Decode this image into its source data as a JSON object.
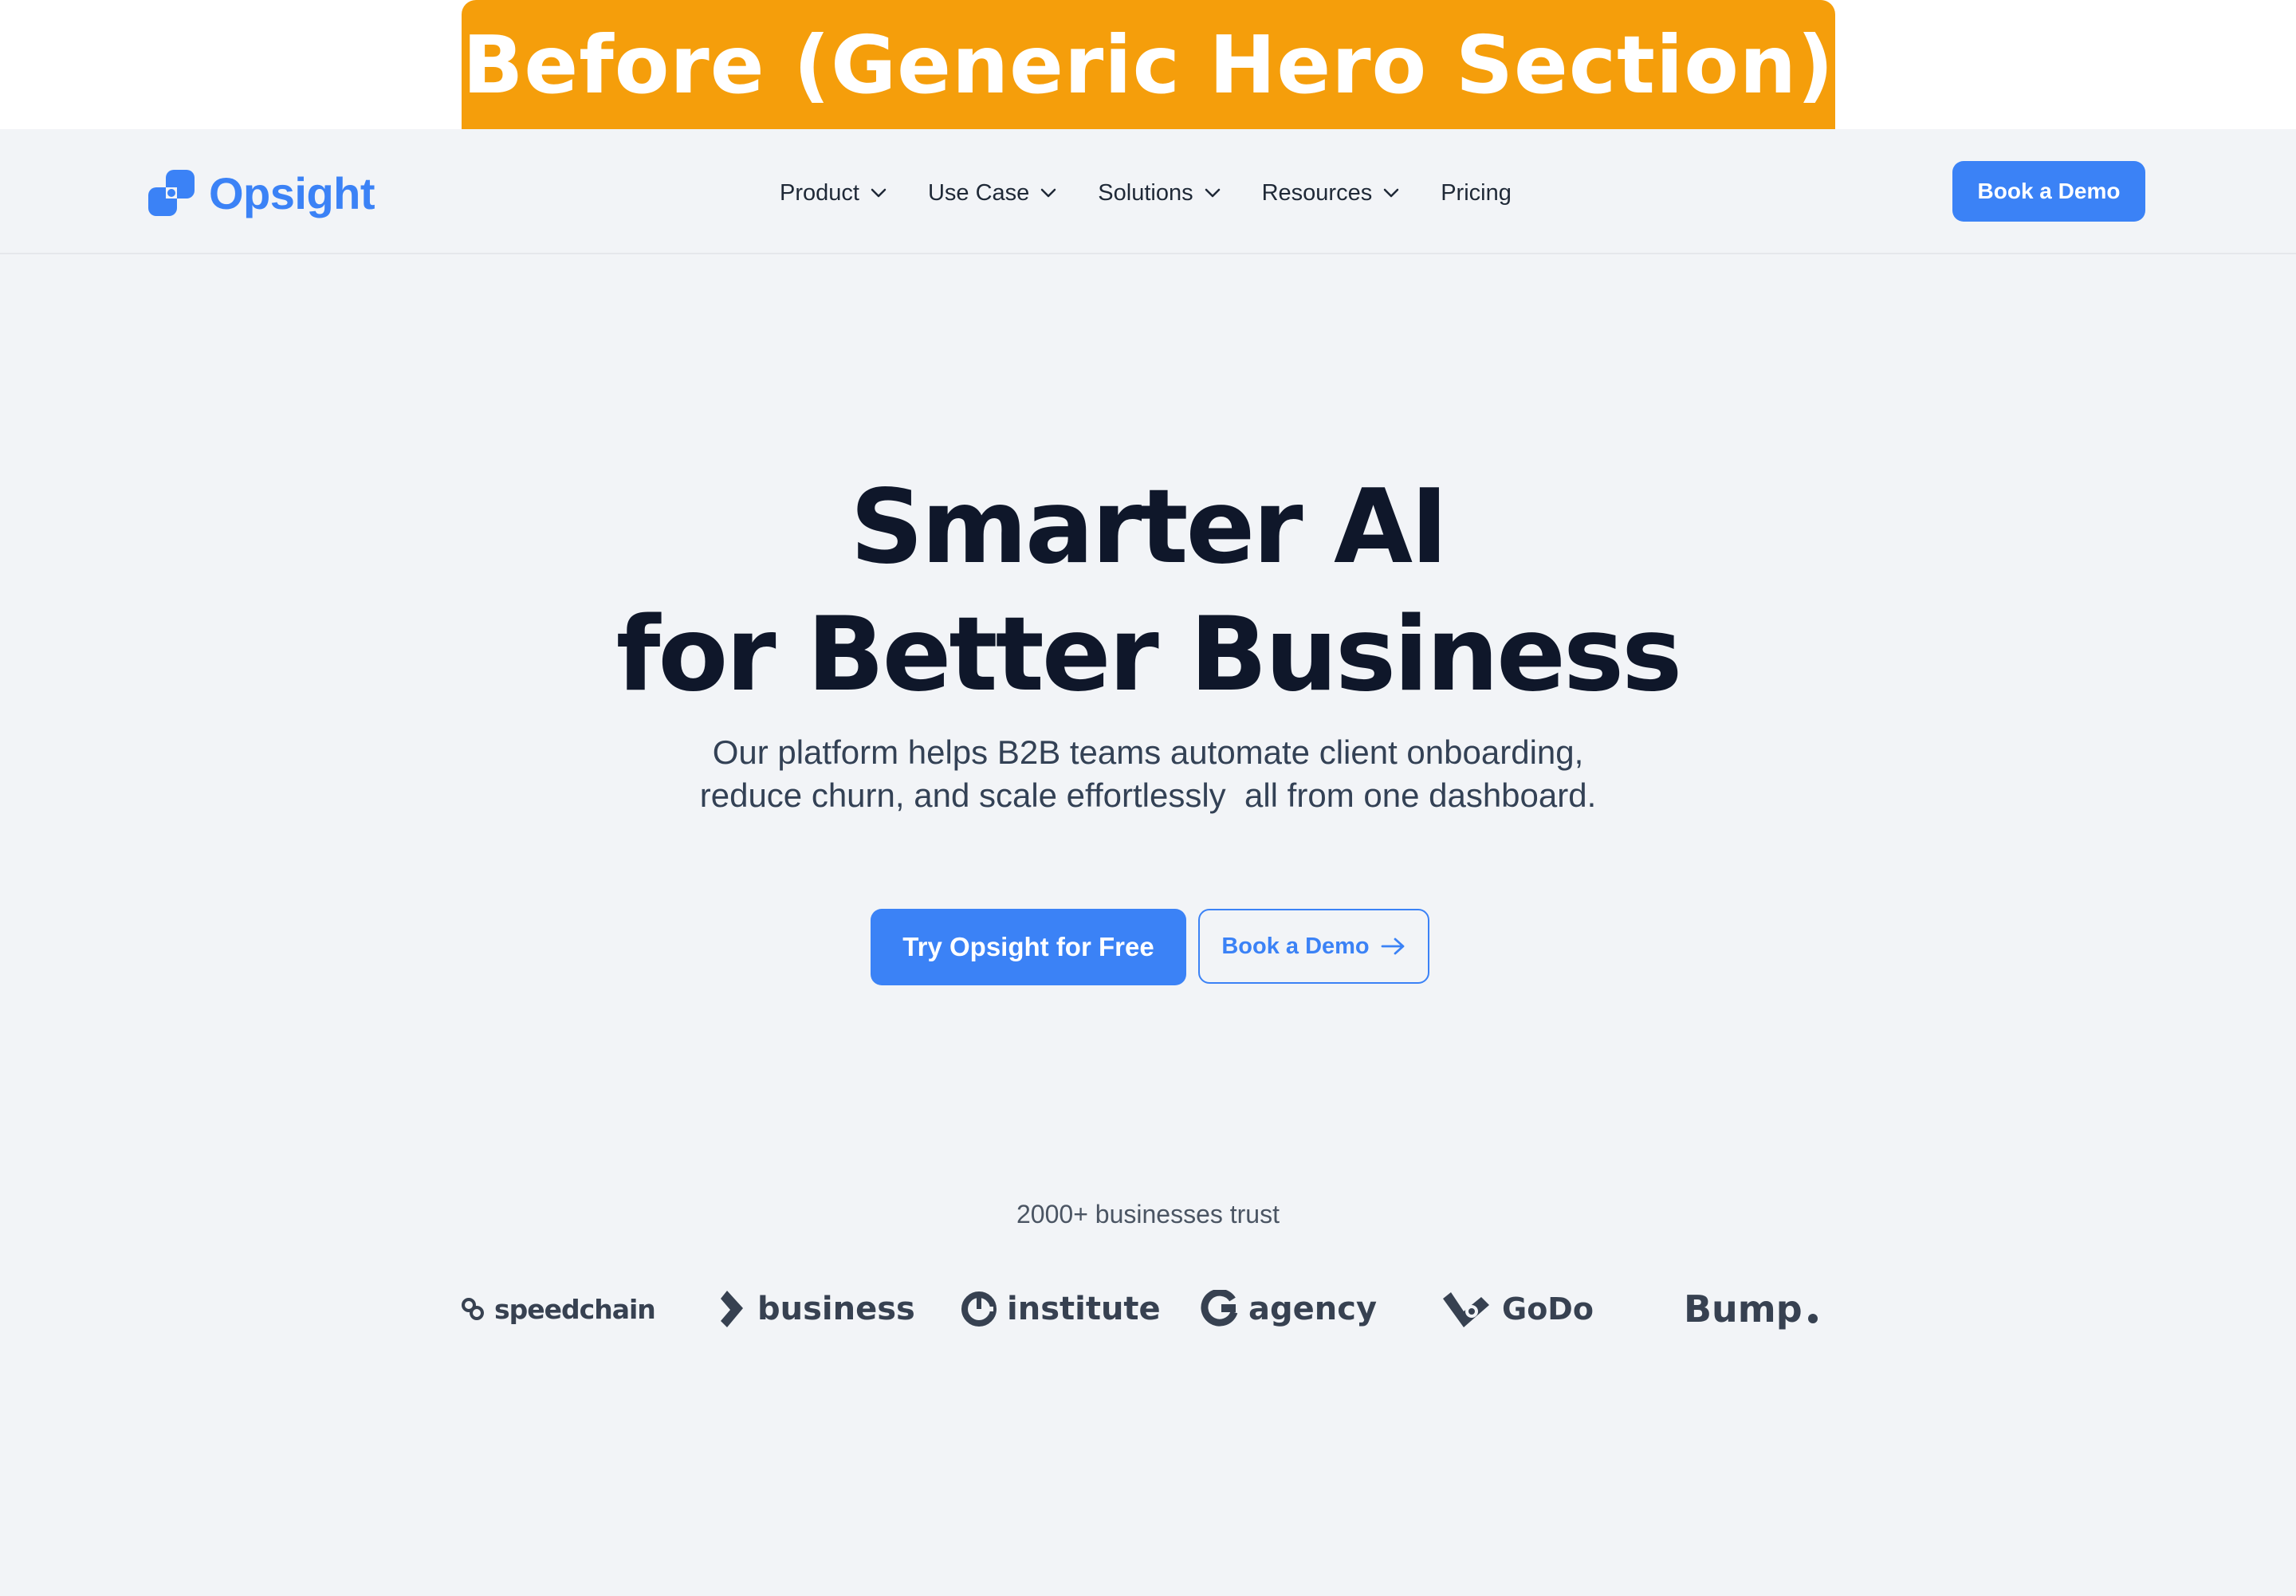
{
  "banner": {
    "title": "Before (Generic Hero Section)"
  },
  "nav": {
    "brand": "Opsight",
    "links": [
      {
        "label": "Product",
        "has_dropdown": true
      },
      {
        "label": "Use Case",
        "has_dropdown": true
      },
      {
        "label": "Solutions",
        "has_dropdown": true
      },
      {
        "label": "Resources",
        "has_dropdown": true
      },
      {
        "label": "Pricing",
        "has_dropdown": false
      }
    ],
    "cta_label": "Book a Demo"
  },
  "hero": {
    "title_line1": "Smarter AI",
    "title_line2": "for Better Business",
    "subtitle_line1": "Our platform helps B2B teams automate client onboarding,",
    "subtitle_line2": "reduce churn, and scale effortlessly  all from one dashboard.",
    "primary_cta": "Try Opsight for Free",
    "secondary_cta": "Book a Demo"
  },
  "trust": {
    "label": "2000+ businesses trust",
    "logos": [
      {
        "name": "speedchain",
        "icon": "speedchain-logo-icon"
      },
      {
        "name": "business",
        "icon": "business-logo-icon"
      },
      {
        "name": "institute",
        "icon": "institute-logo-icon"
      },
      {
        "name": "agency",
        "icon": "agency-logo-icon"
      },
      {
        "name": "GoDo",
        "icon": "godo-logo-icon"
      },
      {
        "name": "Bump",
        "icon": "bump-dot-icon"
      }
    ]
  },
  "colors": {
    "banner": "#F59E0B",
    "accent": "#3B82F6",
    "page_bg": "#F2F4F7",
    "heading": "#0F172A"
  }
}
